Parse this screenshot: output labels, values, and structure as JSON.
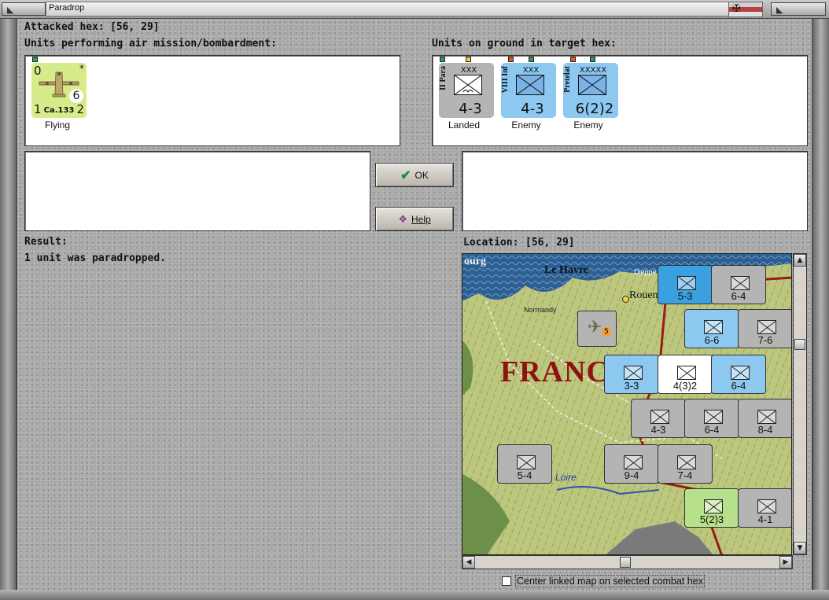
{
  "window": {
    "title": "Paradrop"
  },
  "attacked_hex": {
    "label": "Attacked hex:",
    "value": "[56, 29]"
  },
  "air_panel": {
    "heading": "Units performing air mission/bombardment:",
    "units": [
      {
        "top_left": "0",
        "top_right": "*",
        "range": "6",
        "bottom_left": "1",
        "bottom_right": "2",
        "name": "Ca.133",
        "status": "Flying",
        "color": "#d6ec8a"
      }
    ]
  },
  "ground_panel": {
    "heading": "Units on ground in target hex:",
    "units": [
      {
        "size": "XXX",
        "name": "II Para",
        "strength": "4-3",
        "status": "Landed",
        "color": "#b4b4b4"
      },
      {
        "size": "XXX",
        "name": "VIII Inf",
        "strength": "4-3",
        "status": "Enemy",
        "color": "#8cc8f0"
      },
      {
        "size": "XXXXX",
        "name": "Pretelat",
        "strength": "6(2)2",
        "status": "Enemy",
        "color": "#8cc8f0"
      }
    ]
  },
  "buttons": {
    "ok": "OK",
    "help": "Help"
  },
  "result": {
    "label": "Result:",
    "text": "1 unit was paradropped."
  },
  "location": {
    "label": "Location:",
    "value": "[56, 29]"
  },
  "map": {
    "place_names": [
      "ourg",
      "Le Havre",
      "Dieppe",
      "Rouen",
      "Normandy",
      "FRANC",
      "Loire"
    ],
    "counters": [
      {
        "label": "5-3",
        "color": "#3aa0e0"
      },
      {
        "label": "6-4",
        "color": "#b4b4b4"
      },
      {
        "label": "6-6",
        "color": "#8cc8f0"
      },
      {
        "label": "7-6",
        "color": "#b4b4b4"
      },
      {
        "label": "3-3",
        "color": "#8cc8f0"
      },
      {
        "label": "4(3)2",
        "color": "#ffffff"
      },
      {
        "label": "6-4",
        "color": "#8cc8f0"
      },
      {
        "label": "4-3",
        "color": "#b4b4b4"
      },
      {
        "label": "6-4",
        "color": "#b4b4b4"
      },
      {
        "label": "8-4",
        "color": "#b4b4b4"
      },
      {
        "label": "5-4",
        "color": "#b4b4b4"
      },
      {
        "label": "9-4",
        "color": "#b4b4b4"
      },
      {
        "label": "7-4",
        "color": "#b4b4b4"
      },
      {
        "label": "5(2)3",
        "color": "#b6e08a"
      },
      {
        "label": "4-1",
        "color": "#b4b4b4"
      }
    ]
  },
  "center_map_checkbox": {
    "label": "Center linked map on selected combat hex",
    "checked": false
  }
}
